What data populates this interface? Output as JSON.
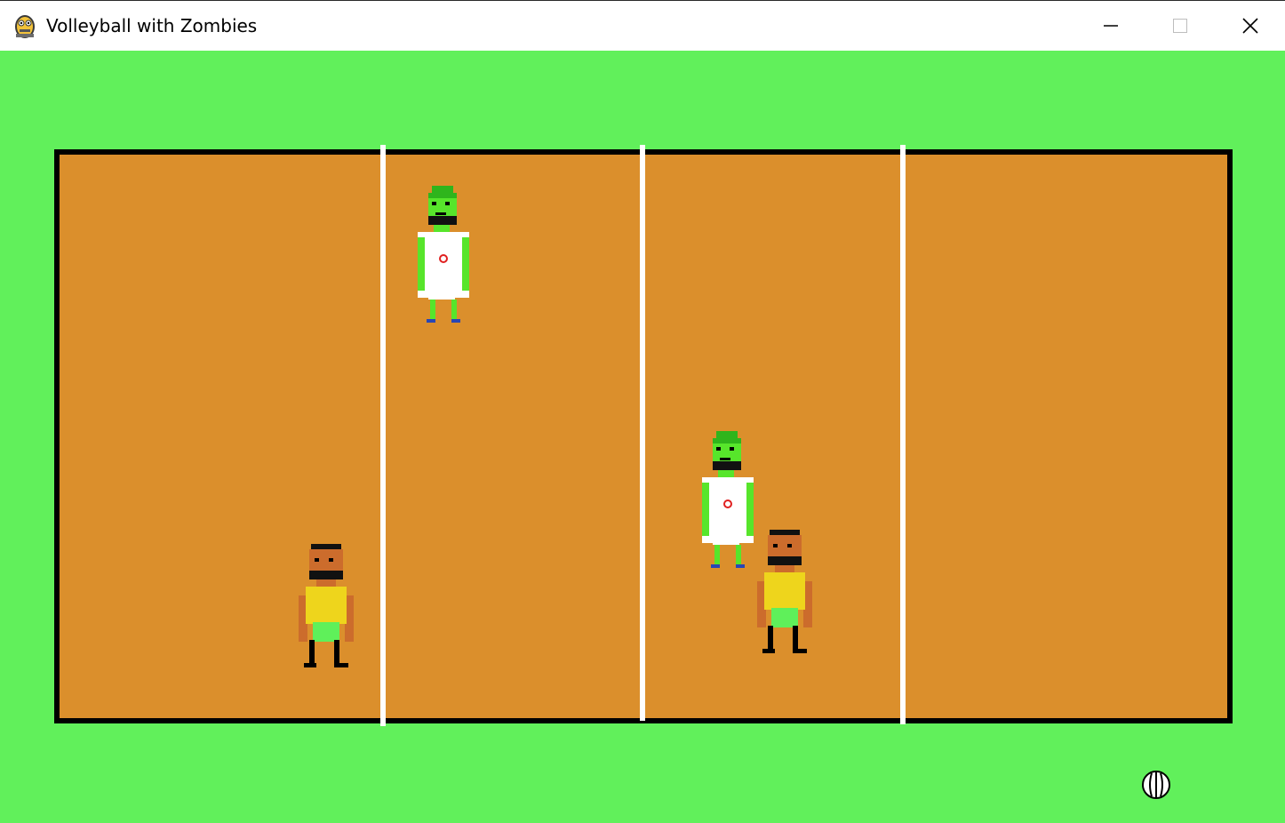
{
  "window": {
    "title": "Volleyball with Zombies",
    "icon": "pygame-snake-icon"
  },
  "controls": [
    "minimize-icon",
    "maximize-icon",
    "close-icon"
  ],
  "colors": {
    "grass": "#61f05b",
    "court": "#db8f2c",
    "court_border": "#000000",
    "court_lines": "#ffffff",
    "zombie_skin": "#57e52b",
    "zombie_shirt": "#ffffff",
    "human_skin": "#cc6c2c",
    "human_shirt": "#eed51c",
    "human_shorts": "#5ff05a"
  },
  "court": {
    "zones": 4
  },
  "players": [
    {
      "type": "zombie",
      "team": "opponent"
    },
    {
      "type": "zombie",
      "team": "opponent"
    },
    {
      "type": "human",
      "team": "player"
    },
    {
      "type": "human",
      "team": "player"
    }
  ],
  "ball": {
    "type": "volleyball"
  }
}
